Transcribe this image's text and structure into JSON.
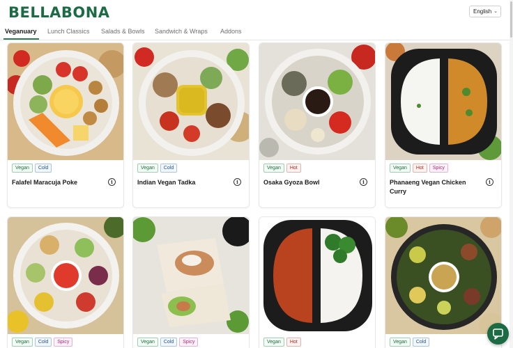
{
  "brand": {
    "name": "BELLABONA",
    "color": "#1d6b45"
  },
  "language": {
    "selected": "English"
  },
  "tabs": [
    {
      "label": "Veganuary"
    },
    {
      "label": "Lunch Classics"
    },
    {
      "label": "Salads & Bowls"
    },
    {
      "label": "Sandwich & Wraps"
    },
    {
      "label": "Addons"
    }
  ],
  "active_tab": "Veganuary",
  "info_glyph": "i",
  "products": [
    {
      "name": "Falafel Maracuja Poke",
      "tags": [
        "Vegan",
        "Cold"
      ],
      "image_icon": "falafel-bowl"
    },
    {
      "name": "Indian Vegan Tadka",
      "tags": [
        "Vegan",
        "Cold"
      ],
      "image_icon": "tadka-bowl"
    },
    {
      "name": "Osaka Gyoza Bowl",
      "tags": [
        "Vegan",
        "Hot"
      ],
      "image_icon": "gyoza-bowl"
    },
    {
      "name": "Phanaeng Vegan Chicken Curry",
      "tags": [
        "Vegan",
        "Hot",
        "Spicy"
      ],
      "image_icon": "curry-tray"
    },
    {
      "name": "",
      "tags": [
        "Vegan",
        "Cold",
        "Spicy"
      ],
      "image_icon": "salad-bowl"
    },
    {
      "name": "",
      "tags": [
        "Vegan",
        "Cold",
        "Spicy"
      ],
      "image_icon": "wrap"
    },
    {
      "name": "",
      "tags": [
        "Vegan",
        "Hot"
      ],
      "image_icon": "soup-tray"
    },
    {
      "name": "",
      "tags": [
        "Vegan",
        "Cold"
      ],
      "image_icon": "tofu-salad"
    }
  ],
  "tag_colors": {
    "Vegan": "#1f6b3d",
    "Cold": "#1f4f8f",
    "Hot": "#b0281c",
    "Spicy": "#b0237a"
  },
  "icons": {
    "chat": "chat-bubble-icon",
    "info": "info-icon",
    "dropdown": "chevron-down-icon"
  }
}
